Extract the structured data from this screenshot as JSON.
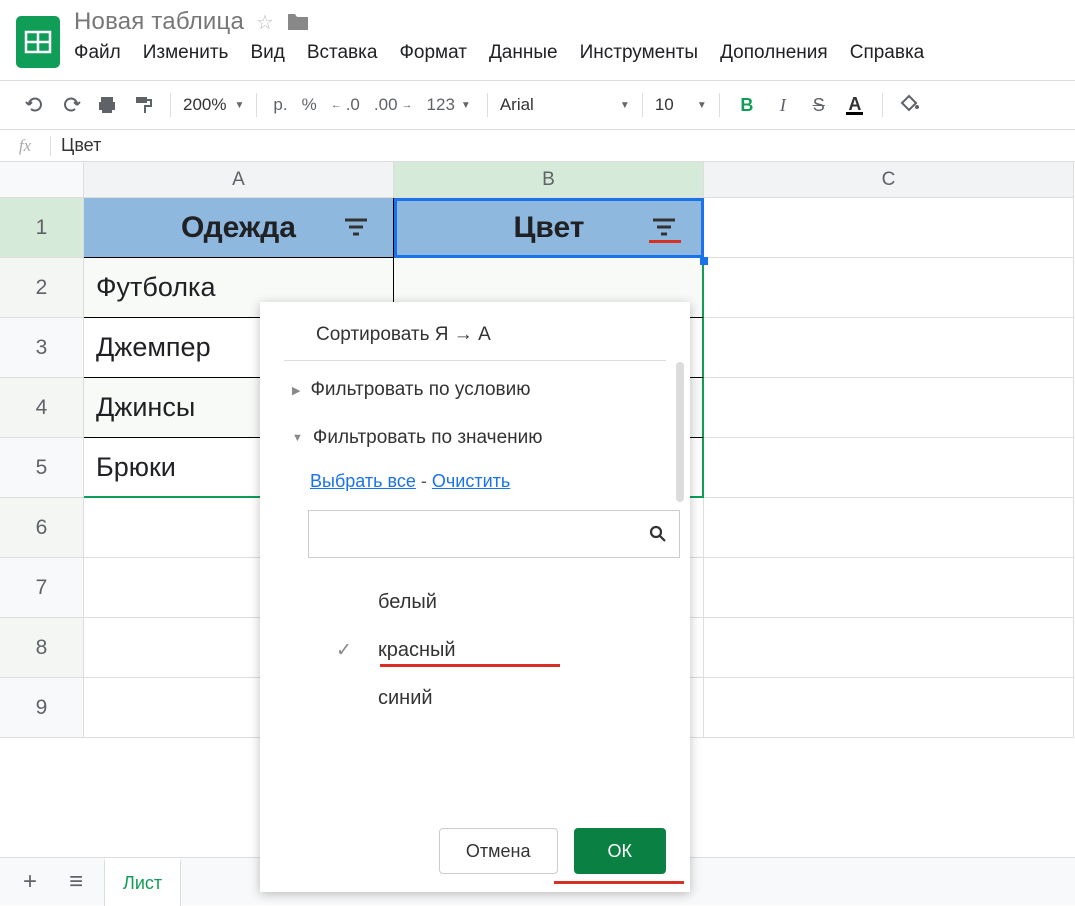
{
  "header": {
    "doc_title": "Новая таблица",
    "menus": [
      "Файл",
      "Изменить",
      "Вид",
      "Вставка",
      "Формат",
      "Данные",
      "Инструменты",
      "Дополнения",
      "Справка"
    ]
  },
  "toolbar": {
    "zoom": "200%",
    "currency": "р.",
    "percent": "%",
    "dec_dec": ".0",
    "inc_dec": ".00",
    "num_fmt": "123",
    "font": "Arial",
    "font_size": "10"
  },
  "formula": {
    "fx_label": "fx",
    "value": "Цвет"
  },
  "columns": {
    "a": "A",
    "b": "B",
    "c": "C"
  },
  "rows": [
    "1",
    "2",
    "3",
    "4",
    "5",
    "6",
    "7",
    "8",
    "9"
  ],
  "cells": {
    "a1": "Одежда",
    "b1": "Цвет",
    "a2": "Футболка",
    "a3": "Джемпер",
    "a4": "Джинсы",
    "a5": "Брюки"
  },
  "filter": {
    "sort_desc": "Сортировать Я → А",
    "by_condition": "Фильтровать по условию",
    "by_value": "Фильтровать по значению",
    "select_all": "Выбрать все",
    "clear": "Очистить",
    "search_placeholder": "",
    "values": [
      {
        "label": "белый",
        "checked": false
      },
      {
        "label": "красный",
        "checked": true
      },
      {
        "label": "синий",
        "checked": false
      }
    ],
    "cancel": "Отмена",
    "ok": "ОК"
  },
  "tabs": {
    "sheet1": "Лист"
  }
}
